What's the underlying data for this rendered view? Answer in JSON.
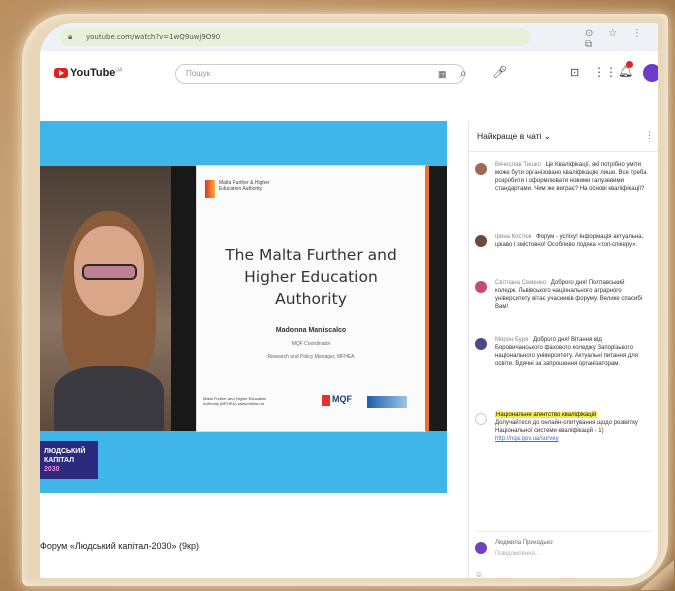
{
  "browser": {
    "url": "youtube.com/watch?v=1wQ9uwj9O90",
    "toolbar_icons": "⊙ ☆ ⋮ ⧉"
  },
  "youtube": {
    "logo_text": "YouTube",
    "logo_sup": "UA",
    "search_placeholder": "Пошук",
    "keyboard_icon": "▦",
    "search_icon": "⌕",
    "mic_icon": "🎤",
    "cast_icon": "⊡",
    "apps_icon": "⋮⋮",
    "bell_icon": "🔔"
  },
  "slide": {
    "org_logo_text": "Malta Further & Higher Education Authority",
    "title": "The Malta Further and Higher Education Authority",
    "presenter": "Madonna Maniscalco",
    "role": "MQF Coordinator",
    "role2": "Research and Policy Manager, MFHEA",
    "footer": "Malta Further and Higher Education Authority (MFHEA) www.mfhea.mt",
    "mqf_label": "MQF"
  },
  "event_logo": {
    "line1": "ЛЮДСЬКИЙ",
    "line2": "КАПІТАЛ",
    "year": "2030"
  },
  "video_title": "Форум «Людський капітал-2030» (9кр)",
  "chat": {
    "title": "Найкраще в чаті ⌄",
    "more_icon": "⋮",
    "messages": [
      {
        "author": "Вячеслав Тишко",
        "text": "Це Кваліфікації, які потрібно уміти може бути організовано кваліфікацію лише. Все треба розробити і оформлювати новими галузевими стандартами. Чим же виграє? На основі кваліфікації?",
        "color": "#9a6a52"
      },
      {
        "author": "Ірина Костюк",
        "text": "Форум - успіху! Інформація актуальна, цікаво і змістовно! Особливо подяка «топ-спікеру».",
        "color": "#6a4a3a"
      },
      {
        "author": "Світлана Семенко",
        "text": "Доброго дня! Полтавський коледж. Львівського національного аграрного університету вітає учасників форуму. Велике спасибі Вам!",
        "color": "#c84a7a"
      },
      {
        "author": "Мирон Буря",
        "text": "Доброго дня! Вітання від Боровичанського фахового коледжу Запорізького національного університету. Актуальні питання для освіти. Вдячні за запрошення організаторам.",
        "color": "#4a4a8a"
      },
      {
        "author": "",
        "highlight": "Національне агентство кваліфікацій",
        "text": "Долучайтеся до онлайн-опитування щодо розвитку Національної системи кваліфікацій - 1)",
        "link": "http://nqa.gov.ua/survey",
        "color": "#ffffff"
      }
    ],
    "input_name": "Людмила Приходько",
    "input_placeholder": "Повідомлення...",
    "bottom_icon": "☺"
  }
}
